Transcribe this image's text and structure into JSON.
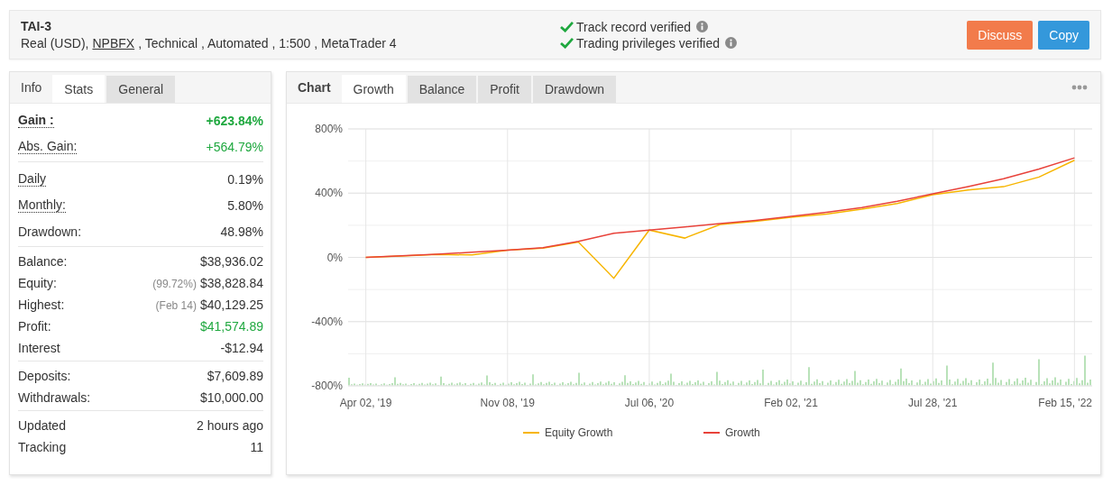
{
  "header": {
    "title": "TAI-3",
    "subtitle_before": "Real (USD),",
    "broker_link": "NPBFX",
    "subtitle_after": ", Technical , Automated , 1:500 , MetaTrader 4",
    "verifications": [
      {
        "label": "Track record verified",
        "verified": true
      },
      {
        "label": "Trading privileges verified",
        "verified": true
      }
    ],
    "buttons": [
      {
        "label": "Discuss",
        "kind": "discuss"
      },
      {
        "label": "Copy",
        "kind": "copy"
      }
    ]
  },
  "stats_panel": {
    "title": "Info",
    "tabs": [
      {
        "label": "Stats",
        "selected": true
      },
      {
        "label": "General",
        "selected": false
      }
    ],
    "groups": [
      [
        {
          "label": "Gain :",
          "value": "+623.84%",
          "bold": true,
          "tooltip": true,
          "positive": true
        },
        {
          "label": "Abs. Gain:",
          "value": "+564.79%",
          "bold": false,
          "tooltip": true,
          "positive": true
        }
      ],
      [
        {
          "label": "Daily",
          "value": "0.19%",
          "bold": false,
          "tooltip": true,
          "positive": false
        },
        {
          "label": "Monthly:",
          "value": "5.80%",
          "bold": false,
          "tooltip": true,
          "positive": false
        },
        {
          "label": "Drawdown:",
          "value": "48.98%",
          "bold": false,
          "tooltip": false,
          "positive": false
        }
      ],
      [
        {
          "label": "Balance:",
          "value": "$38,936.02",
          "bold": false,
          "tooltip": false,
          "positive": false
        },
        {
          "label": "Equity:",
          "note": "(99.72%)",
          "value": "$38,828.84",
          "bold": false,
          "tooltip": false,
          "positive": false
        },
        {
          "label": "Highest:",
          "note": "(Feb 14)",
          "value": "$40,129.25",
          "bold": false,
          "tooltip": false,
          "positive": false
        },
        {
          "label": "Profit:",
          "value": "$41,574.89",
          "bold": false,
          "tooltip": false,
          "positive": true
        },
        {
          "label": "Interest",
          "value": "-$12.94",
          "bold": false,
          "tooltip": false,
          "positive": false
        }
      ],
      [
        {
          "label": "Deposits:",
          "value": "$7,609.89",
          "bold": false,
          "tooltip": false,
          "positive": false
        },
        {
          "label": "Withdrawals:",
          "value": "$10,000.00",
          "bold": false,
          "tooltip": false,
          "positive": false
        }
      ],
      [
        {
          "label": "Updated",
          "value": "2 hours ago",
          "bold": false,
          "tooltip": false,
          "positive": false
        },
        {
          "label": "Tracking",
          "value": "11",
          "bold": false,
          "tooltip": false,
          "positive": false
        }
      ]
    ]
  },
  "chart_panel": {
    "title": "Chart",
    "tabs": [
      {
        "label": "Growth",
        "selected": true
      },
      {
        "label": "Balance",
        "selected": false
      },
      {
        "label": "Profit",
        "selected": false
      },
      {
        "label": "Drawdown",
        "selected": false
      }
    ],
    "chart_data": {
      "type": "line",
      "categories": [
        "Apr 02, '19",
        null,
        null,
        null,
        "Nov 08, '19",
        null,
        null,
        null,
        "Jul 06, '20",
        null,
        null,
        null,
        "Feb 02, '21",
        null,
        null,
        null,
        "Jul 28, '21",
        null,
        null,
        null,
        "Feb 15, '22"
      ],
      "ylim": [
        -800,
        800
      ],
      "grid": true,
      "legend": "bottom",
      "yticks": [
        {
          "value": 800,
          "label": "800%"
        },
        {
          "value": 400,
          "label": "400%"
        },
        {
          "value": 0,
          "label": "0%"
        },
        {
          "value": -400,
          "label": "-400%"
        },
        {
          "value": -800,
          "label": "-800%"
        }
      ],
      "series": [
        {
          "name": "Equity Growth",
          "color": "#f7b500",
          "values": [
            0,
            8,
            18,
            15,
            45,
            58,
            95,
            -130,
            170,
            120,
            205,
            225,
            250,
            270,
            300,
            335,
            390,
            420,
            440,
            500,
            605
          ]
        },
        {
          "name": "Growth",
          "color": "#e8423a",
          "values": [
            0,
            10,
            20,
            32,
            45,
            60,
            100,
            150,
            170,
            190,
            210,
            230,
            255,
            280,
            310,
            350,
            395,
            440,
            490,
            550,
            620
          ]
        }
      ]
    }
  }
}
